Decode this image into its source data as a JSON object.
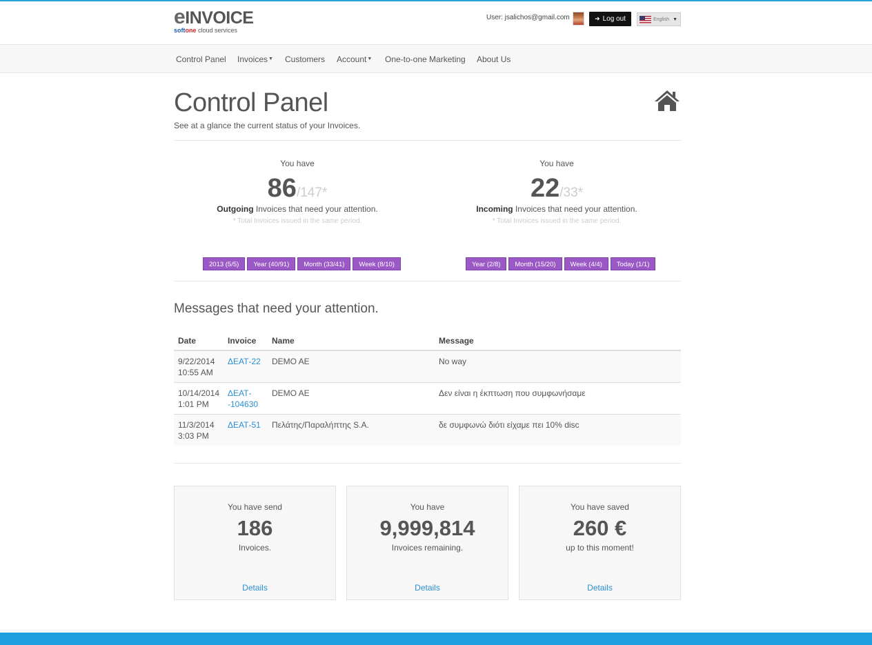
{
  "header": {
    "logo_main": "INVOICE",
    "logo_e": "e",
    "logo_sub_soft": "soft",
    "logo_sub_one": "one",
    "logo_sub_rest": " cloud services",
    "user_text": "User: jsalichos@gmail.com",
    "logout_label": "Log out",
    "language": "English"
  },
  "nav": {
    "items": [
      {
        "label": "Control Panel"
      },
      {
        "label": "Invoices"
      },
      {
        "label": "Customers"
      },
      {
        "label": "Account"
      },
      {
        "label": "One-to-one Marketing"
      },
      {
        "label": "About Us"
      }
    ]
  },
  "page": {
    "title": "Control Panel",
    "subtitle": "See at a glance the current status of your Invoices."
  },
  "stats": {
    "outgoing": {
      "you_have": "You have",
      "count": "86",
      "total": "/147*",
      "type": "Outgoing",
      "desc": " Invoices that need your attention.",
      "note": "* Total Invoices issued in the same period.",
      "filters": [
        "2013 (5/5)",
        "Year (40/91)",
        "Month (33/41)",
        "Week (8/10)"
      ]
    },
    "incoming": {
      "you_have": "You have",
      "count": "22",
      "total": "/33*",
      "type": "Incoming",
      "desc": " Invoices that need your attention.",
      "note": "* Total Invoices issued in the same period.",
      "filters": [
        "Year (2/8)",
        "Month (15/20)",
        "Week (4/4)",
        "Today (1/1)"
      ]
    },
    "pill_color": "#9b59c5"
  },
  "messages": {
    "title": "Messages that need your attention.",
    "columns": [
      "Date",
      "Invoice",
      "Name",
      "Message"
    ],
    "rows": [
      {
        "date1": "9/22/2014",
        "date2": "10:55 AM",
        "invoice1": "ΔΕΑΤ-22",
        "invoice2": "",
        "name": "DEMO AE",
        "message": "No way"
      },
      {
        "date1": "10/14/2014",
        "date2": "1:01 PM",
        "invoice1": "ΔΕΑΤ-",
        "invoice2": "-104630",
        "name": "DEMO AE",
        "message": "Δεν είναι η έκπτωση που συμφωνήσαμε"
      },
      {
        "date1": "11/3/2014",
        "date2": "3:03 PM",
        "invoice1": "ΔΕΑΤ-51",
        "invoice2": "",
        "name": "Πελάτης/Παραλήπτης S.A.",
        "message": "δε συμφωνώ διότι είχαμε πει 10% disc"
      }
    ]
  },
  "cards": [
    {
      "pre": "You have send",
      "number": "186",
      "post": "Invoices.",
      "link": "Details"
    },
    {
      "pre": "You have",
      "number": "9,999,814",
      "post": "Invoices remaining.",
      "link": "Details"
    },
    {
      "pre": "You have saved",
      "number": "260 €",
      "post": "up to this moment!",
      "link": "Details"
    }
  ],
  "colors": {
    "accent_blue": "#1e9fe0",
    "link": "#2a8fd4"
  }
}
